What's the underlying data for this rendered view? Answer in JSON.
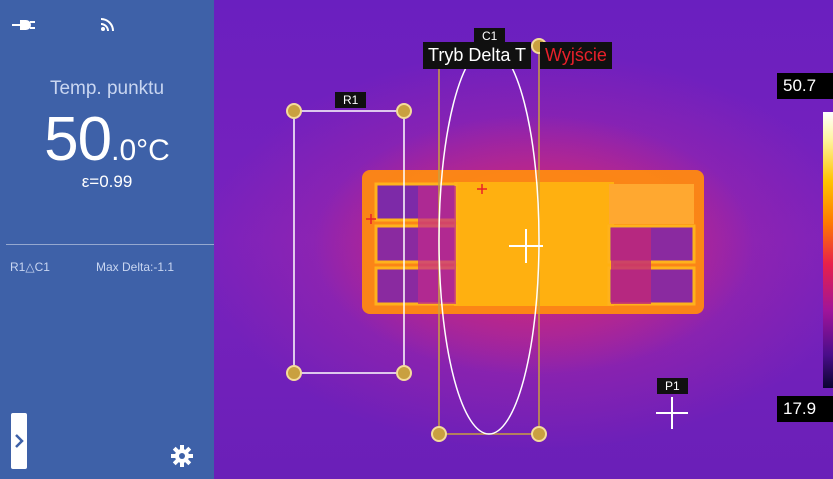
{
  "status_bar": {
    "power_icon": "plug-icon",
    "wifi_icon": "wifi-icon"
  },
  "readout": {
    "label": "Temp. punktu",
    "value_int": "50",
    "value_dec": ".0",
    "unit": "°C",
    "emissivity": "ε=0.99"
  },
  "delta": {
    "pair": "R1△C1",
    "max": "Max Delta:-1.1"
  },
  "controls": {
    "expand_icon": "chevron-right-icon",
    "settings_icon": "gear-icon"
  },
  "mode": {
    "label": "Tryb Delta T",
    "exit": "Wyjście"
  },
  "rois": {
    "rect_label": "R1",
    "ellipse_label": "C1",
    "point_label": "P1"
  },
  "scale": {
    "max": "50.7",
    "min": "17.9"
  },
  "colors": {
    "sidebar": "#3e61a8",
    "handle": "#c9a040",
    "exit_text": "#e8202a"
  }
}
